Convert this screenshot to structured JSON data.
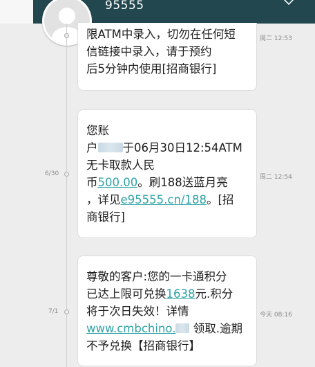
{
  "header": {
    "sender_number": "95555"
  },
  "messages": [
    {
      "date": "",
      "time": "周二 12:53",
      "lines": [
        "限ATM中录入，切勿在任何短",
        "信链接中录入，请于预约",
        "后5分钟内使用[招商银行]"
      ]
    },
    {
      "date": "6/30",
      "time": "周二 12:54",
      "line1": "您账",
      "line2_prefix": "户",
      "line2_suffix": "于06月30日12:54ATM",
      "line3": "无卡取款人民",
      "line4_prefix": "币",
      "amount": "500.00",
      "line4_suffix": "。刷188送蓝月亮",
      "line5_prefix": "，详见",
      "url": "e95555.cn/188",
      "line5_suffix": "。[招",
      "line6": "商银行]"
    },
    {
      "date": "7/1",
      "time": "今天 08:16",
      "line1": "尊敬的客户:您的一卡通积分",
      "line2_prefix": "已达上限可兑换",
      "points": "1638",
      "line2_suffix": "元.积分",
      "line3": "将于次日失效！详情",
      "url": "www.cmbchino.",
      "line4_suffix": " 领取.逾期",
      "line5": "不予兑换【招商银行】"
    }
  ],
  "colors": {
    "header_bg": "#22474f",
    "link": "#2fa3a6",
    "background": "#ededed"
  },
  "icons": {
    "avatar": "default-person-icon",
    "expand": "chevron-down-icon"
  }
}
